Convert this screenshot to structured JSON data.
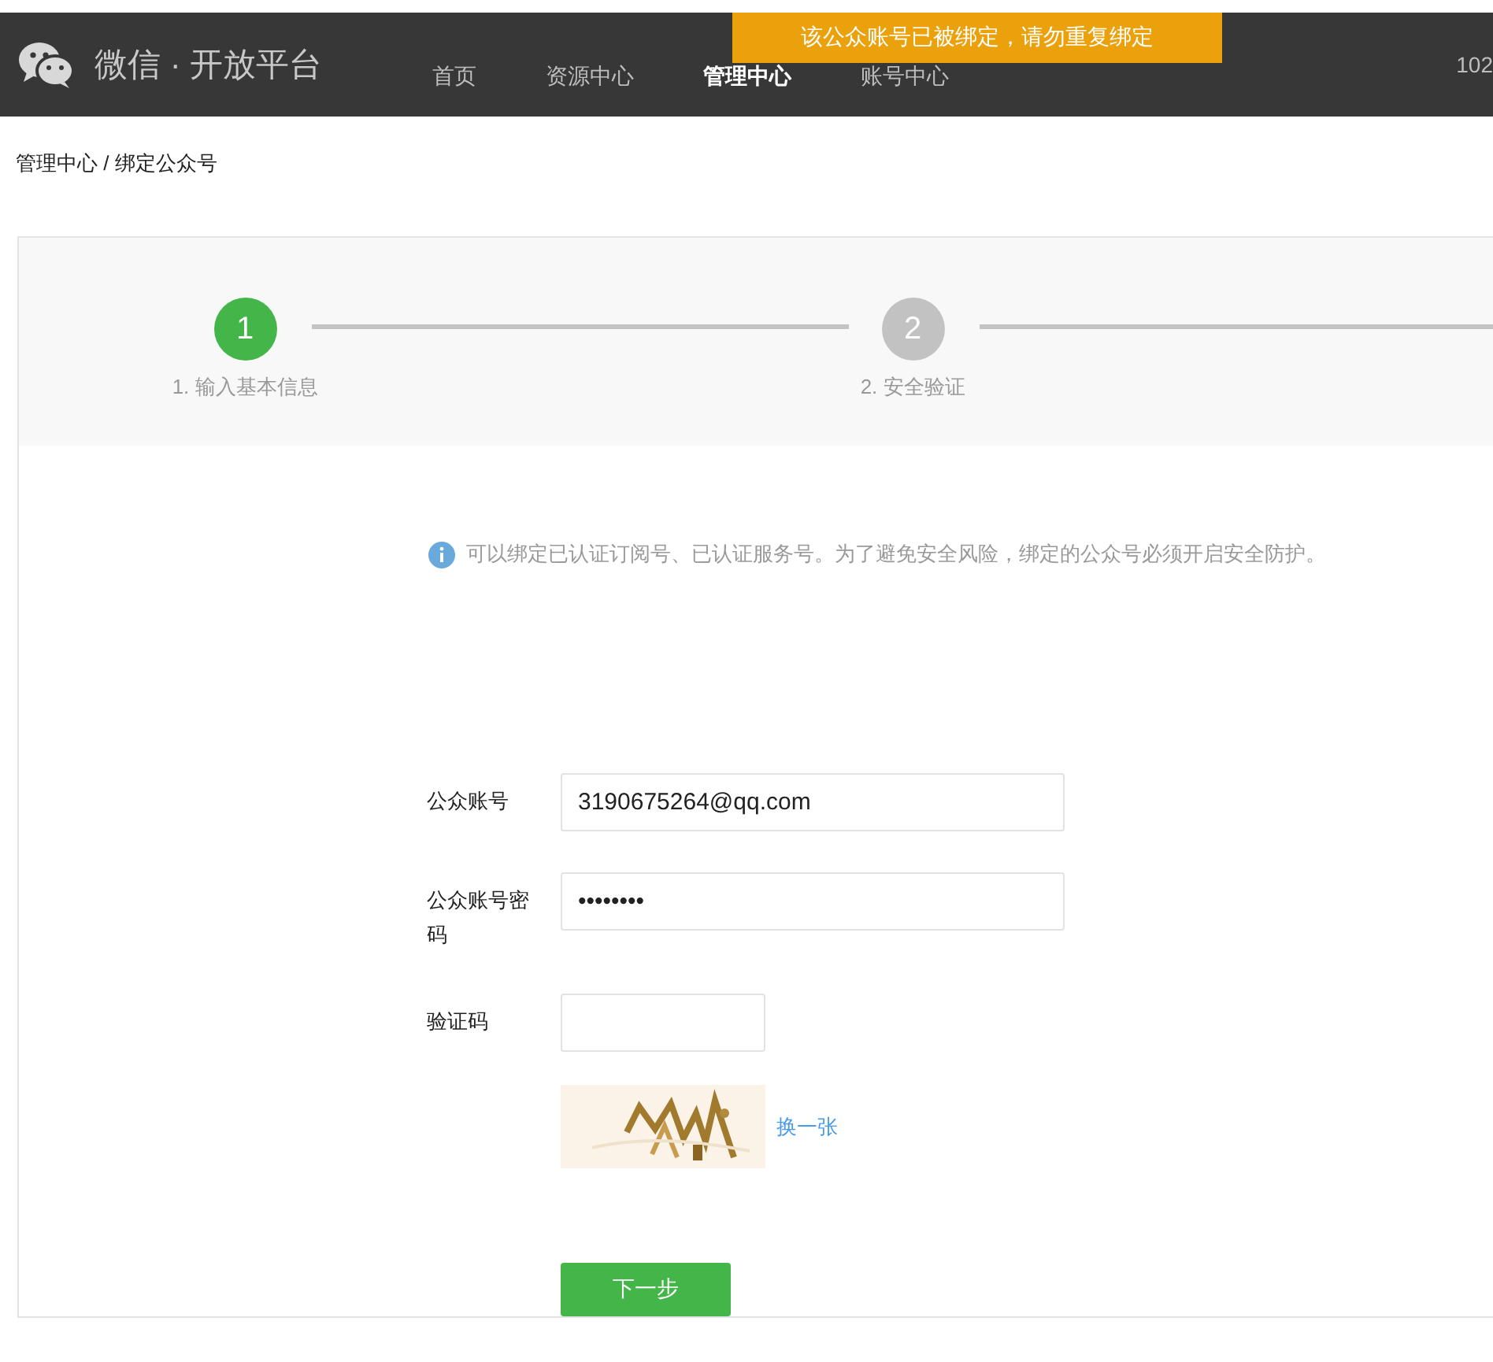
{
  "header": {
    "title": "微信 · 开放平台",
    "nav": [
      {
        "label": "首页",
        "selected": false
      },
      {
        "label": "资源中心",
        "selected": false
      },
      {
        "label": "管理中心",
        "selected": true
      },
      {
        "label": "账号中心",
        "selected": false
      }
    ],
    "user": "102"
  },
  "toast": "该公众账号已被绑定，请勿重复绑定",
  "breadcrumb": "管理中心 / 绑定公众号",
  "steps": [
    {
      "number": "1",
      "label": "1. 输入基本信息",
      "active": true
    },
    {
      "number": "2",
      "label": "2. 安全验证",
      "active": false
    }
  ],
  "notice": "可以绑定已认证订阅号、已认证服务号。为了避免安全风险，绑定的公众号必须开启安全防护。",
  "form": {
    "fields": [
      {
        "kind": "text",
        "label": "公众账号",
        "value": "3190675264@qq.com"
      },
      {
        "kind": "text",
        "label": "公众账号密码",
        "value": "••••••••"
      },
      {
        "kind": "short",
        "label": "验证码"
      }
    ],
    "captcha": {
      "kind": "picture",
      "refresh_link": "换一张"
    },
    "submit": "下一步"
  }
}
